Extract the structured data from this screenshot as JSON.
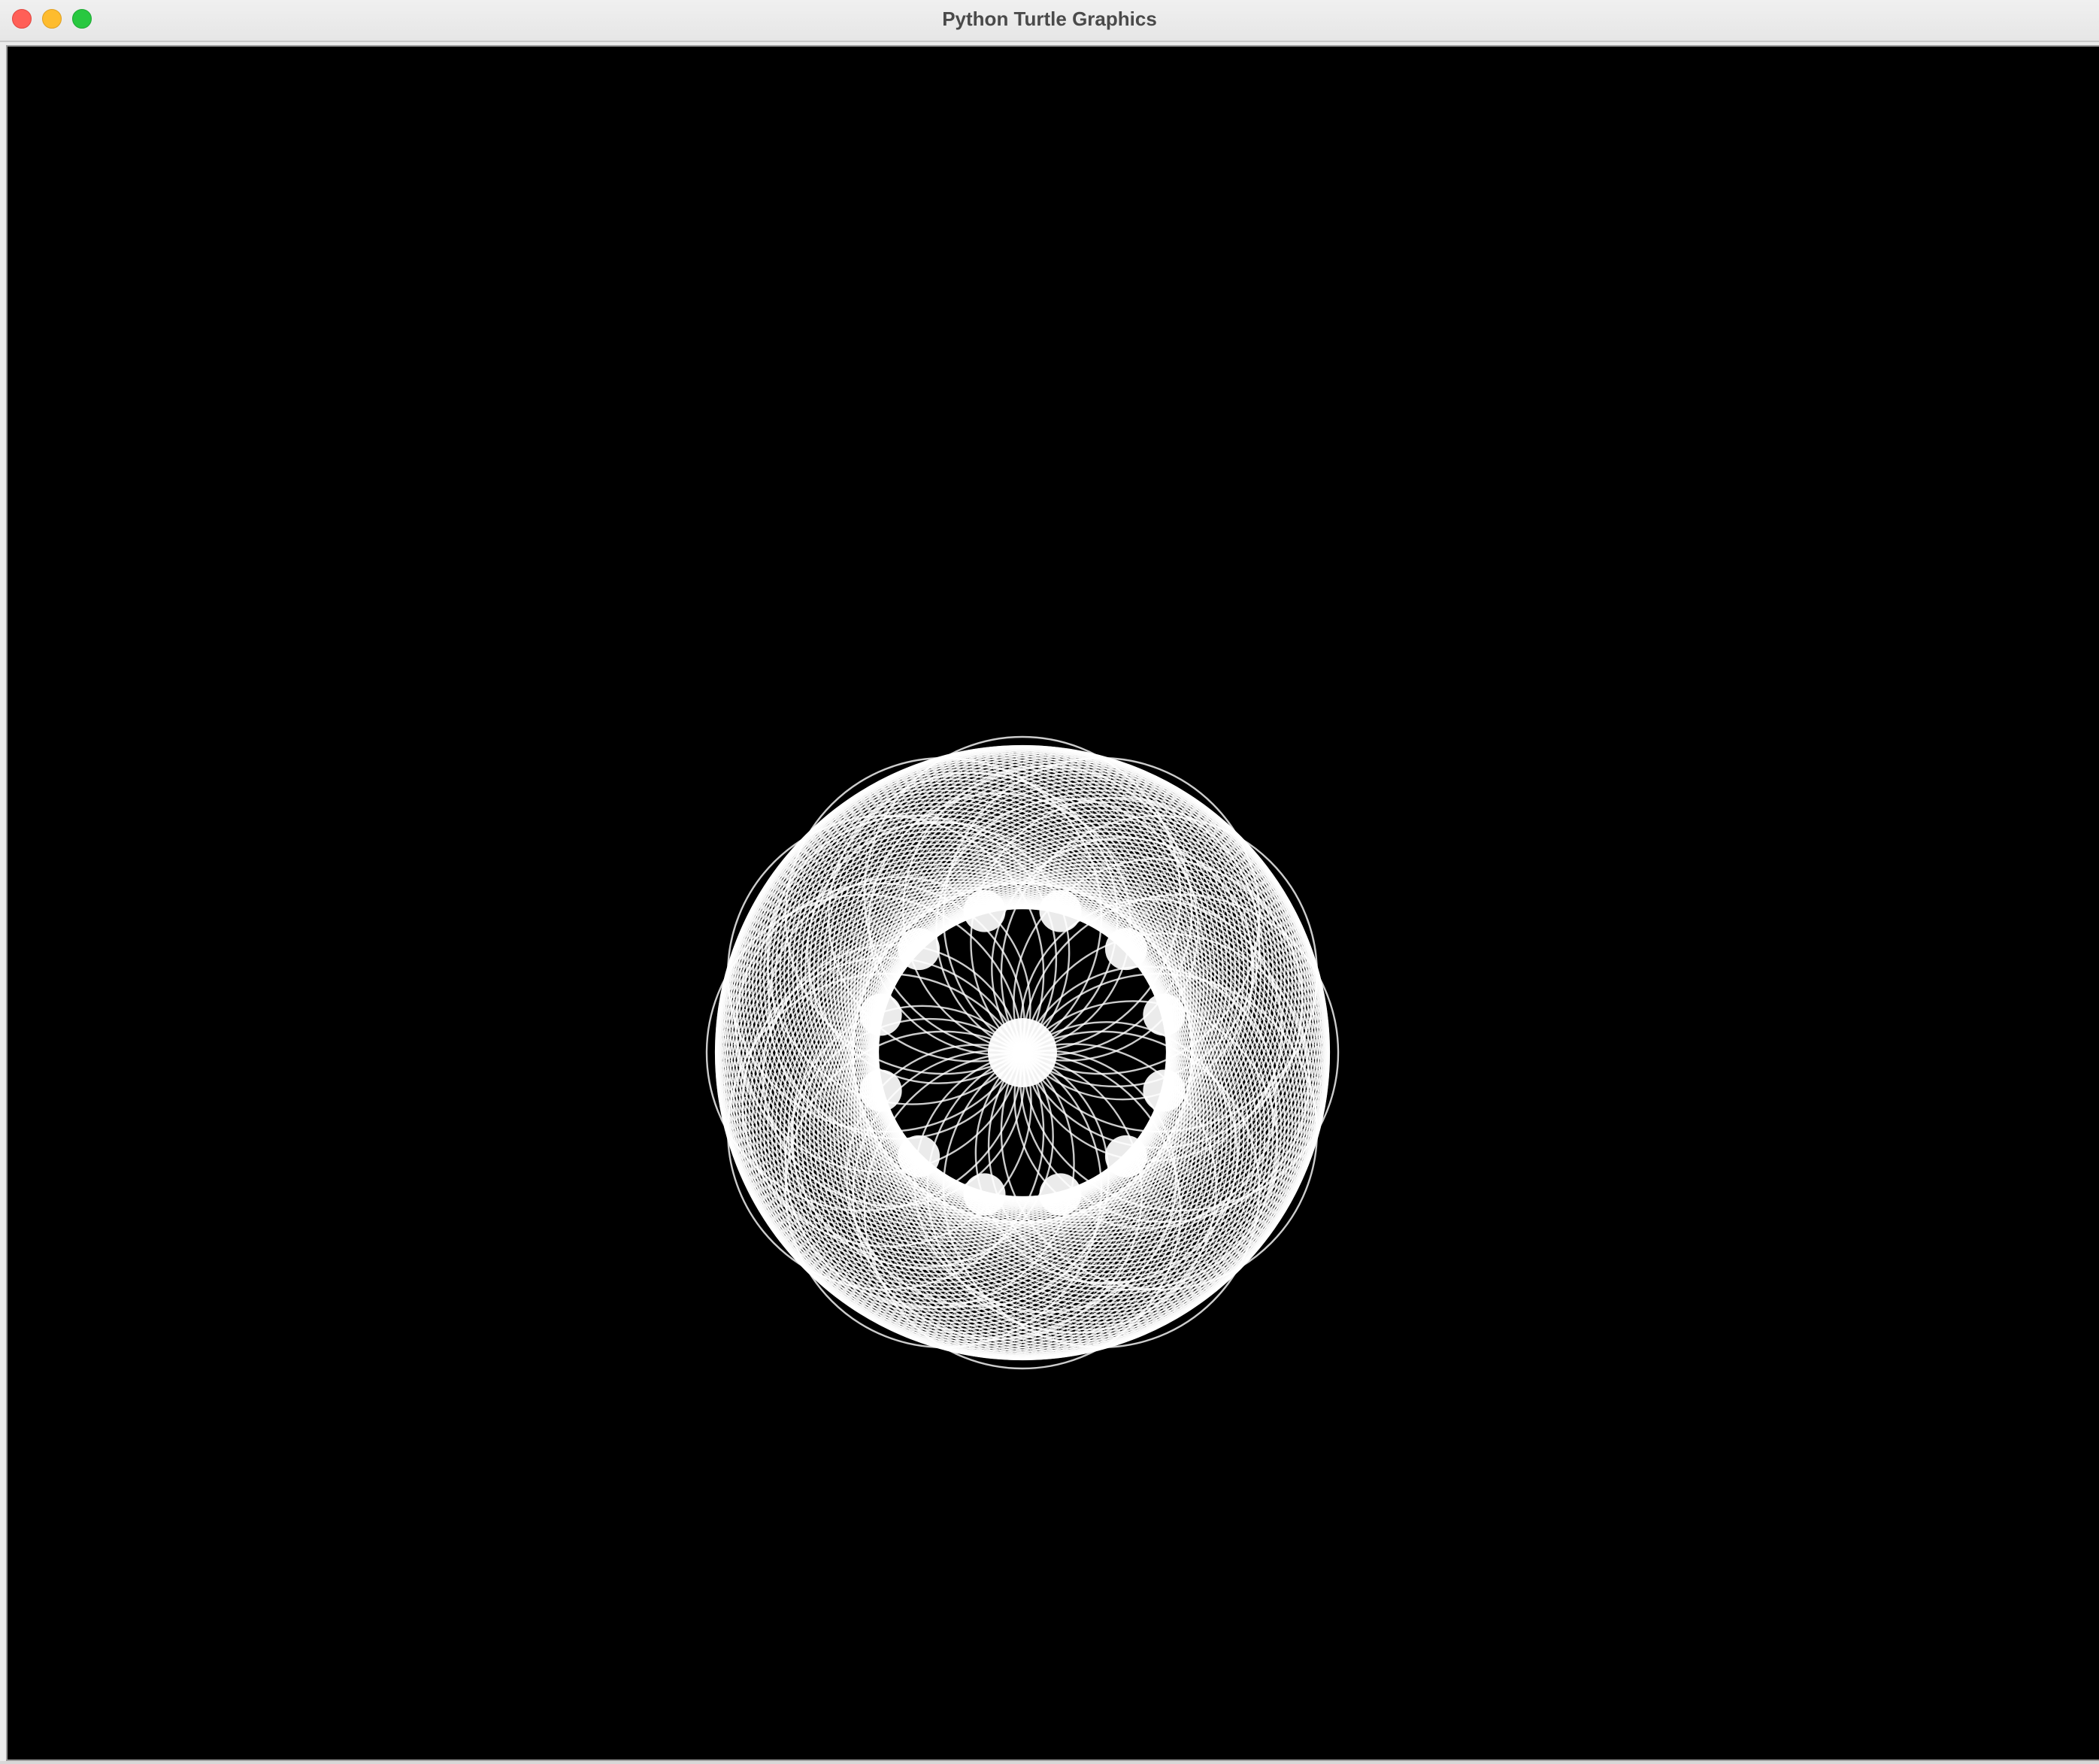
{
  "window": {
    "title": "Python Turtle Graphics",
    "traffic_lights": {
      "close": "close-icon",
      "minimize": "minimize-icon",
      "maximize": "maximize-icon"
    }
  },
  "canvas": {
    "background_color": "#000000",
    "pen_color": "#ffffff",
    "drawing": "spirograph-rosette"
  }
}
